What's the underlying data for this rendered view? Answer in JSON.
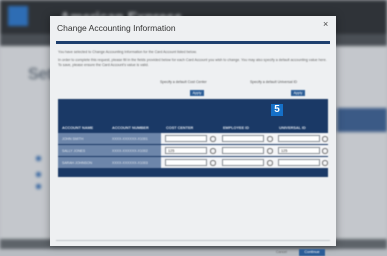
{
  "background": {
    "brand": "American Express",
    "page_title": "Set"
  },
  "modal": {
    "title": "Change Accounting Information",
    "close_label": "×",
    "intro_text": "You have selected to Change Accounting Information for the Card Account listed below.",
    "instructions": "In order to complete this request, please fill in the fields provided below for each Card Account you wish to change. You may also specify a default accounting value here. To save, please ensure the Card Account's value is valid.",
    "default_cost_center_label": "Specify a default Cost Center",
    "default_universal_label": "Specify a default Universal ID",
    "apply_label": "Apply",
    "columns": [
      "ACCOUNT NAME",
      "ACCOUNT NUMBER",
      "COST CENTER",
      "EMPLOYEE ID",
      "UNIVERSAL ID"
    ],
    "rows": [
      {
        "name": "JOHN SMITH",
        "number": "XXXX-XXXXXX-X1001",
        "cost_center": "",
        "employee_id": "",
        "universal_id": ""
      },
      {
        "name": "SALLY JONES",
        "number": "XXXX-XXXXXX-X1002",
        "cost_center": "125",
        "employee_id": "",
        "universal_id": "125"
      },
      {
        "name": "SARAH JOHNSON",
        "number": "XXXX-XXXXXX-X1003",
        "cost_center": "",
        "employee_id": "",
        "universal_id": ""
      }
    ],
    "step_badge": "5",
    "footer_link": "Cancel",
    "footer_button": "Continue"
  }
}
